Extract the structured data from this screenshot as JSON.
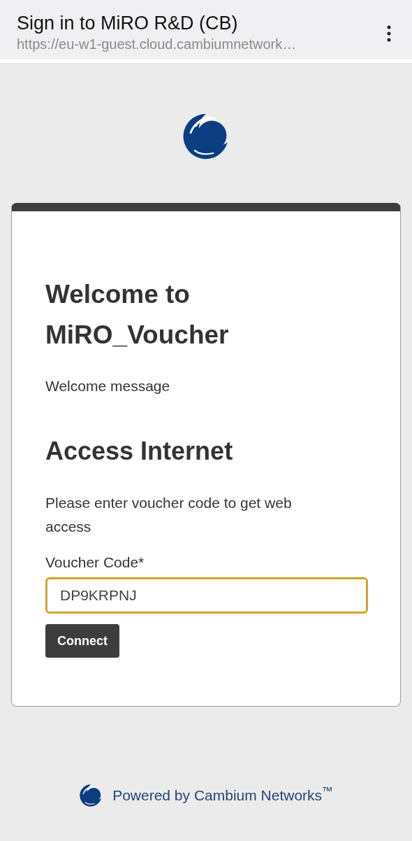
{
  "browser_bar": {
    "title": "Sign in to MiRO R&D (CB)",
    "url": "https://eu-w1-guest.cloud.cambiumnetwork…"
  },
  "card": {
    "heading": "Welcome to MiRO_Voucher",
    "message": "Welcome message",
    "section_title": "Access Internet",
    "instructions": "Please enter voucher code to get web access",
    "field": {
      "label": "Voucher Code*",
      "value": "DP9KRPNJ",
      "focused": true
    },
    "button": "Connect"
  },
  "footer": "Powered by Cambium Networks$^{™}$"
}
